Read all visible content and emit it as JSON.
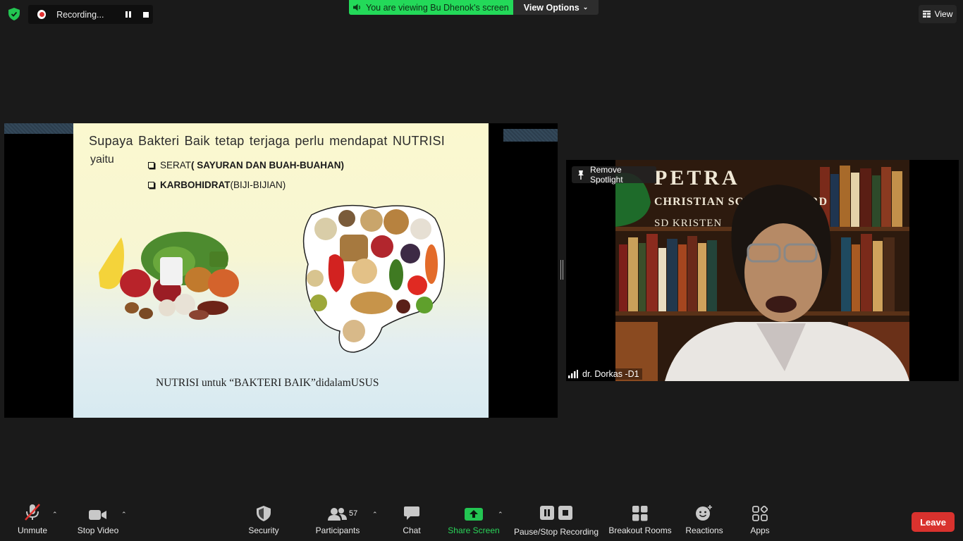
{
  "top_bar": {
    "recording_label": "Recording...",
    "viewing_label": "You are viewing Bu Dhenok's screen",
    "view_options_label": "View Options",
    "view_label": "View"
  },
  "slide": {
    "title_line1": "Supaya  Bakteri Baik tetap terjaga perlu  mendapat NUTRISI",
    "title_line2": "yaitu",
    "bullets": [
      {
        "prefix": "SERAT",
        "bold": " ( SAYURAN DAN BUAH-BUAHAN)"
      },
      {
        "prefix": "KARBOHIDRAT",
        "rest": " (BIJI-BIJIAN)"
      }
    ],
    "caption": "NUTRISI untuk “BAKTERI BAIK”didalamUSUS"
  },
  "speaker": {
    "remove_spotlight_label": "Remove Spotlight",
    "name": "dr. Dorkas -D1",
    "background_text": [
      "PETRA",
      "CHRISTIAN  SCHOOL  BOARD",
      "SD  KRISTEN"
    ]
  },
  "toolbar": {
    "unmute": "Unmute",
    "stop_video": "Stop Video",
    "security": "Security",
    "participants": "Participants",
    "participants_count": "57",
    "chat": "Chat",
    "share_screen": "Share Screen",
    "pause_stop_recording": "Pause/Stop Recording",
    "breakout_rooms": "Breakout Rooms",
    "reactions": "Reactions",
    "apps": "Apps",
    "leave": "Leave"
  },
  "colors": {
    "accent_green": "#23d959",
    "leave_red": "#d9322e",
    "background": "#1a1a1a"
  }
}
